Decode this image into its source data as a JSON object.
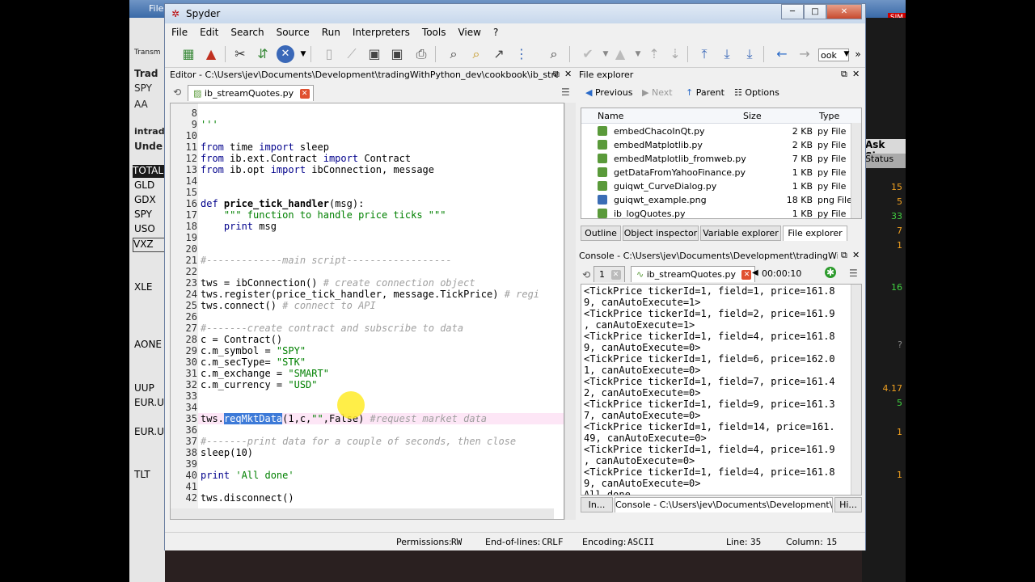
{
  "background": {
    "file_menu": "File",
    "sim": "SIM",
    "left_labels": [
      "Transm",
      "Trad",
      "SPY",
      "AA",
      "intrad",
      "Unde"
    ],
    "symbols": [
      "TOTAL",
      "GLD",
      "GDX",
      "SPY",
      "USO",
      "VXZ",
      "XLE",
      "AONE",
      "UUP",
      "EUR.U",
      "EUR.U",
      "TLT"
    ],
    "right_header": "Ask Size",
    "right_sub": "Status",
    "right_values": [
      "15",
      "5",
      "33",
      "7",
      "1",
      "16",
      "?",
      "4.17",
      "5",
      "1",
      "1"
    ]
  },
  "window": {
    "title": "Spyder",
    "minimize": "─",
    "maximize": "□",
    "close": "✕"
  },
  "menu": [
    "File",
    "Edit",
    "Search",
    "Source",
    "Run",
    "Interpreters",
    "Tools",
    "View",
    "?"
  ],
  "toolbar": {
    "field_value": "ook"
  },
  "editor": {
    "title": "Editor - C:\\Users\\jev\\Documents\\Development\\tradingWithPython_dev\\cookbook\\ib_streamQuotes.py",
    "tab_label": "ib_streamQuotes.py",
    "line_numbers": [
      "8",
      "9",
      "10",
      "11",
      "12",
      "13",
      "14",
      "15",
      "16",
      "17",
      "18",
      "19",
      "20",
      "21",
      "22",
      "23",
      "24",
      "25",
      "26",
      "27",
      "28",
      "29",
      "30",
      "31",
      "32",
      "33",
      "34",
      "35",
      "36",
      "37",
      "38",
      "39",
      "40",
      "41",
      "42"
    ],
    "code": {
      "l9": "'''",
      "l11_a": "from",
      "l11_b": " time ",
      "l11_c": "import",
      "l11_d": " sleep",
      "l12_a": "from",
      "l12_b": " ib.ext.Contract ",
      "l12_c": "import",
      "l12_d": " Contract",
      "l13_a": "from",
      "l13_b": " ib.opt ",
      "l13_c": "import",
      "l13_d": " ibConnection, message",
      "l16_a": "def",
      "l16_b": " ",
      "l16_c": "price_tick_handler",
      "l16_d": "(msg):",
      "l17_a": "    ",
      "l17_b": "\"\"\" function to handle price ticks \"\"\"",
      "l18_a": "    ",
      "l18_b": "print",
      "l18_c": " msg",
      "l22": "#-------------main script------------------",
      "l24_a": "tws = ibConnection() ",
      "l24_b": "# create connection object",
      "l25_a": "tws.register(price_tick_handler, message.TickPrice) ",
      "l25_b": "# regi",
      "l26_a": "tws.connect() ",
      "l26_b": "# connect to API",
      "l28": "#-------create contract and subscribe to data",
      "l29": "c = Contract()",
      "l30_a": "c.m_symbol = ",
      "l30_b": "\"SPY\"",
      "l31_a": "c.m_secType= ",
      "l31_b": "\"STK\"",
      "l32_a": "c.m_exchange = ",
      "l32_b": "\"SMART\"",
      "l33_a": "c.m_currency = ",
      "l33_b": "\"USD\"",
      "l35_a": "tws.",
      "l35_b": "reqMktData",
      "l35_c": "(1,c,",
      "l35_d": "\"\"",
      "l35_e": ",False) ",
      "l35_f": "#request market data",
      "l37": "#-------print data for a couple of seconds, then close",
      "l38": "sleep(10)",
      "l40_a": "print",
      "l40_b": " ",
      "l40_c": "'All done'",
      "l42": "tws.disconnect()"
    }
  },
  "file_explorer": {
    "title": "File explorer",
    "nav": {
      "previous": "Previous",
      "next": "Next",
      "parent": "Parent",
      "options": "Options"
    },
    "columns": {
      "name": "Name",
      "size": "Size",
      "type": "Type"
    },
    "files": [
      {
        "name": "embedChacoInQt.py",
        "size": "2 KB",
        "type": "py File",
        "color": "#5a9a3a"
      },
      {
        "name": "embedMatplotlib.py",
        "size": "2 KB",
        "type": "py File",
        "color": "#5a9a3a"
      },
      {
        "name": "embedMatplotlib_fromweb.py",
        "size": "7 KB",
        "type": "py File",
        "color": "#5a9a3a"
      },
      {
        "name": "getDataFromYahooFinance.py",
        "size": "1 KB",
        "type": "py File",
        "color": "#5a9a3a"
      },
      {
        "name": "guiqwt_CurveDialog.py",
        "size": "1 KB",
        "type": "py File",
        "color": "#5a9a3a"
      },
      {
        "name": "guiqwt_example.png",
        "size": "18 KB",
        "type": "png File",
        "color": "#3b6db5"
      },
      {
        "name": "ib_logQuotes.py",
        "size": "1 KB",
        "type": "py File",
        "color": "#5a9a3a"
      }
    ],
    "tabs": [
      "Outline",
      "Object inspector",
      "Variable explorer",
      "File explorer"
    ]
  },
  "console": {
    "title": "Console - C:\\Users\\jev\\Documents\\Development\\tradingWithPython...",
    "tab1": "1",
    "tab2": "ib_streamQuotes.py",
    "timer": "00:00:10",
    "lines": [
      "<TickPrice tickerId=1, field=1, price=161.8",
      "9, canAutoExecute=1>",
      "<TickPrice tickerId=1, field=2, price=161.9",
      ", canAutoExecute=1>",
      "<TickPrice tickerId=1, field=4, price=161.8",
      "9, canAutoExecute=0>",
      "<TickPrice tickerId=1, field=6, price=162.0",
      "1, canAutoExecute=0>",
      "<TickPrice tickerId=1, field=7, price=161.4",
      "2, canAutoExecute=0>",
      "<TickPrice tickerId=1, field=9, price=161.3",
      "7, canAutoExecute=0>",
      "<TickPrice tickerId=1, field=14, price=161.",
      "49, canAutoExecute=0>",
      "<TickPrice tickerId=1, field=4, price=161.9",
      ", canAutoExecute=0>",
      "<TickPrice tickerId=1, field=4, price=161.8",
      "9, canAutoExecute=0>",
      "All done"
    ],
    "bottom_tabs": [
      "In...",
      "Console - C:\\Users\\jev\\Documents\\Development\\tr...",
      "Hi..."
    ]
  },
  "statusbar": {
    "permissions_label": "Permissions:",
    "permissions_value": "RW",
    "eol_label": "End-of-lines:",
    "eol_value": "CRLF",
    "encoding_label": "Encoding:",
    "encoding_value": "ASCII",
    "line_label": "Line:",
    "line_value": "35",
    "column_label": "Column:",
    "column_value": "15"
  }
}
